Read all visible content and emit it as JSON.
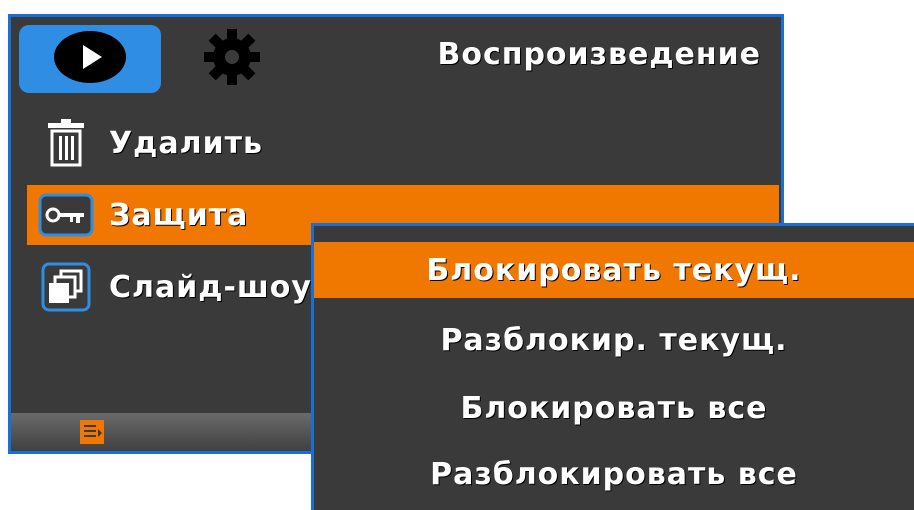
{
  "header": {
    "title": "Воспроизведение",
    "tabs": [
      {
        "name": "play",
        "icon": "play-icon",
        "active": true
      },
      {
        "name": "settings",
        "icon": "gear-icon",
        "active": false
      }
    ]
  },
  "menu": {
    "items": [
      {
        "label": "Удалить",
        "icon": "trash-icon",
        "selected": false
      },
      {
        "label": "Защита",
        "icon": "key-icon",
        "selected": true
      },
      {
        "label": "Слайд-шоу",
        "icon": "slideshow-icon",
        "selected": false
      }
    ]
  },
  "submenu": {
    "items": [
      {
        "label": "Блокировать текущ.",
        "selected": true
      },
      {
        "label": "Разблокир. текущ.",
        "selected": false
      },
      {
        "label": "Блокировать все",
        "selected": false
      },
      {
        "label": "Разблокировать все",
        "selected": false
      }
    ]
  },
  "colors": {
    "accent": "#f07800",
    "tab_active": "#2f8de4",
    "border": "#1a6fd6",
    "background": "#3a3a3a"
  }
}
